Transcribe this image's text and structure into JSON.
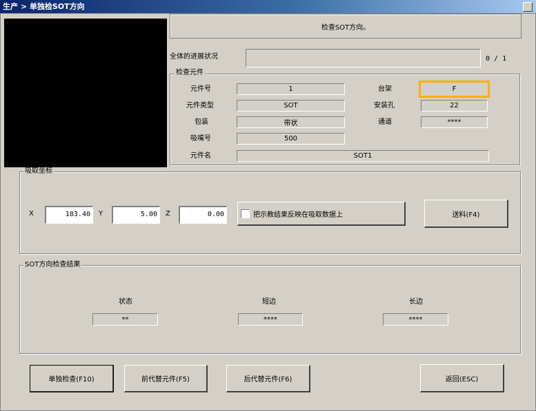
{
  "window": {
    "title": "生产 > 单独检SOT方向"
  },
  "message": "检查SOT方向。",
  "progress": {
    "label": "全体的进展状况",
    "value": 0,
    "count_text": "0 / 1"
  },
  "component_group": {
    "title": "检查元件",
    "part_no_label": "元件号",
    "part_no": "1",
    "part_type_label": "元件类型",
    "part_type": "SOT",
    "package_label": "包装",
    "package": "带状",
    "nozzle_label": "吸嘴号",
    "nozzle": "500",
    "part_name_label": "元件名",
    "part_name": "SOT1",
    "stage_label": "台架",
    "stage": "F",
    "hole_label": "安装孔",
    "hole": "22",
    "lane_label": "通道",
    "lane": "****"
  },
  "pickup": {
    "title": "吸取坐标",
    "x_label": "X",
    "x_value": "183.40",
    "y_label": "Y",
    "y_value": "5.00",
    "z_label": "Z",
    "z_value": "0.00",
    "reflect_label": "把示教结果反映在吸取数据上",
    "feed_button": "送料(F4)"
  },
  "result": {
    "title": "SOT方向检查结果",
    "status_label": "状态",
    "status_value": "**",
    "short_label": "短边",
    "short_value": "****",
    "long_label": "长边",
    "long_value": "****"
  },
  "buttons": {
    "single_check": "单独检查(F10)",
    "prev_alt": "前代替元件(F5)",
    "next_alt": "后代替元件(F6)",
    "back": "返回(ESC)"
  },
  "colors": {
    "highlight": "#f8b100",
    "titlebar": "#0a246a",
    "face": "#d4d0c8"
  }
}
